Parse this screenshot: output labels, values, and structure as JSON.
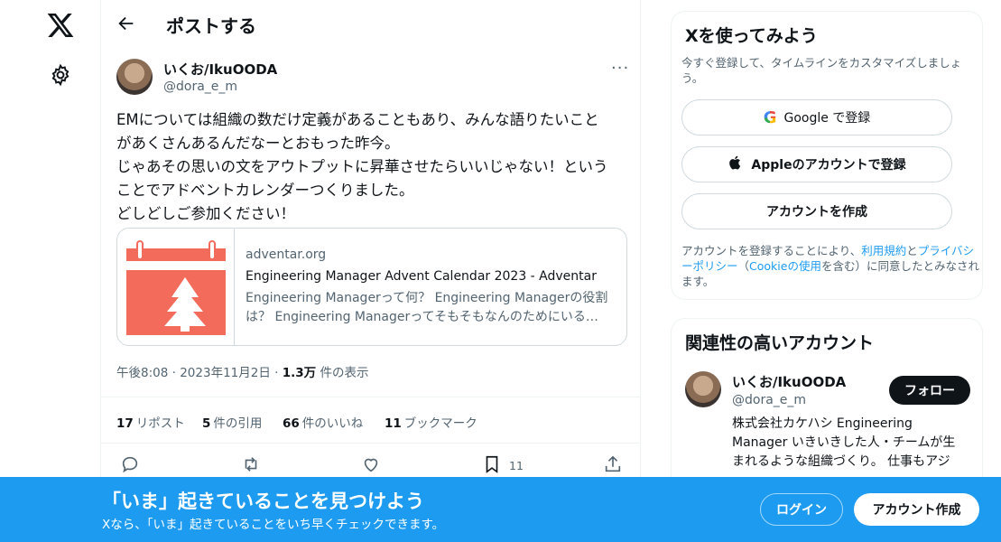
{
  "header": {
    "title": "ポストする"
  },
  "post": {
    "author_name": "いくお/IkuOODA",
    "author_handle": "@dora_e_m",
    "more": "···",
    "text_lines": [
      "EMについては組織の数だけ定義があることもあり、みんな語りたいこと",
      "があくさんあるんだなーとおもった昨今。",
      "じゃあその思いの文をアウトプットに昇華させたらいいじゃない！という",
      "ことでアドベントカレンダーつくりました。",
      "どしどしご参加ください！"
    ],
    "card": {
      "domain": "adventar.org",
      "title": "Engineering Manager Advent Calendar 2023 - Adventar",
      "desc_lines": [
        "Engineering Managerって何？ Engineering Managerの役割",
        "は？ Engineering Managerってそもそもなんのためにいる…"
      ]
    },
    "time": "午後8:08",
    "date": "2023年11月2日",
    "views_count": "1.3万",
    "views_label": "件の表示",
    "reposts_count": "17",
    "reposts_label": "リポスト",
    "quotes_count": "5",
    "quotes_label": "件の引用",
    "likes_count": "66",
    "likes_label": "件のいいね",
    "bookmarks_count": "11",
    "bookmarks_label": "ブックマーク",
    "bookmark_action_count": "11"
  },
  "signup": {
    "title": "Xを使ってみよう",
    "subtitle": "今すぐ登録して、タイムラインをカスタマイズしましょう。",
    "google_label": "Google で登録",
    "apple_label": "Appleのアカウントで登録",
    "create_label": "アカウントを作成",
    "terms_prefix": "アカウントを登録することにより、",
    "terms_link": "利用規約",
    "terms_and": "と",
    "privacy_link": "プライバシーポリシー",
    "cookie_open": "（",
    "cookie_link": "Cookieの使用",
    "cookie_suffix": "を含む）に同意したとみなされます。"
  },
  "related": {
    "title": "関連性の高いアカウント",
    "name": "いくお/IkuOODA",
    "handle": "@dora_e_m",
    "follow_label": "フォロー",
    "bio_lines": [
      "株式会社カケハシ Engineering",
      "Manager いきいきした人・チームが生",
      "まれるような組織づくり。 仕事もアジ"
    ]
  },
  "bottombar": {
    "title": "「いま」起きていることを見つけよう",
    "subtitle": "Xなら、「いま」起きていることをいち早くチェックできます。",
    "login_label": "ログイン",
    "create_label": "アカウント作成"
  },
  "colors": {
    "accent": "#1d9bf0",
    "card_thumb": "#f26b5b"
  }
}
